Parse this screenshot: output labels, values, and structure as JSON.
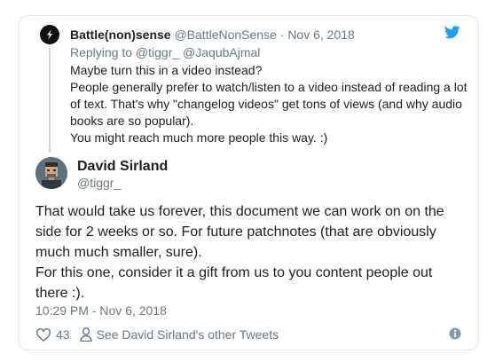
{
  "parent_tweet": {
    "display_name": "Battle(non)sense",
    "handle": "@BattleNonSense",
    "separator": "·",
    "date": "Nov 6, 2018",
    "replying_to": "Replying to @tiggr_ @JaqubAjmal",
    "lines": [
      "Maybe turn this in a video instead?",
      "People generally prefer to watch/listen to a video instead of reading a lot of text. That's why \"changelog videos\" get tons of views (and why audio books are so popular).",
      "You might reach much more people this way. :)"
    ]
  },
  "tweet": {
    "display_name": "David Sirland",
    "handle": "@tiggr_",
    "paragraphs": [
      "That would take us forever, this document we can work on on the side for 2 weeks or so. For future patchnotes (that are obviously much much smaller, sure).",
      "For this one, consider it a gift from us to you content people out there :)."
    ],
    "timestamp": "10:29 PM - Nov 6, 2018",
    "like_count": "43",
    "other_tweets_label": "See David Sirland's other Tweets"
  },
  "colors": {
    "text": "#1c2022",
    "muted": "#697882",
    "twitter_blue": "#1da1f2",
    "border": "#e1e8ed"
  },
  "icons": [
    "battlenonsense-logo-icon",
    "twitter-bird-icon",
    "heart-icon",
    "person-icon",
    "info-icon"
  ]
}
